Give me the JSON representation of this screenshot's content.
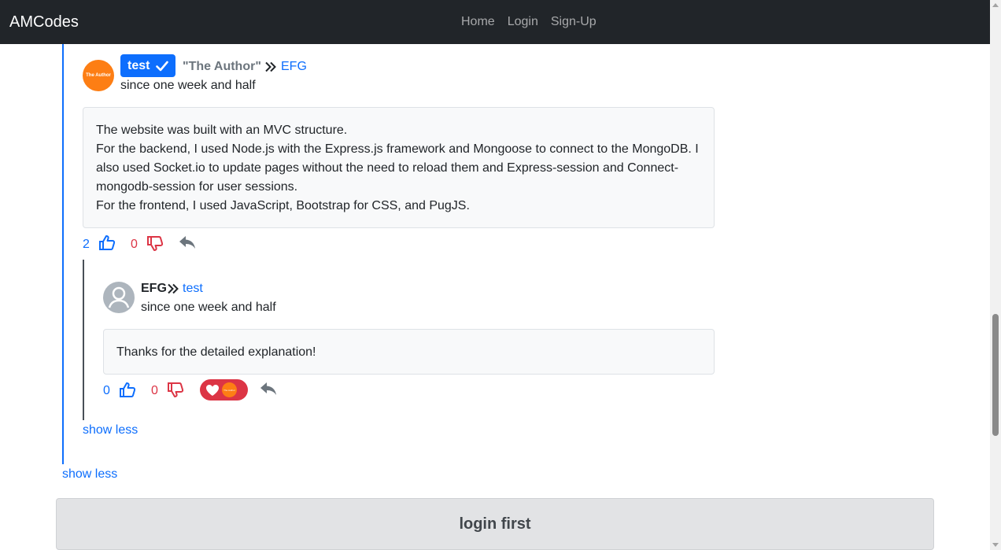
{
  "navbar": {
    "brand": "AMCodes",
    "links": [
      "Home",
      "Login",
      "Sign-Up"
    ]
  },
  "comment": {
    "avatar_text": "The Author",
    "user": "test",
    "author_tag": "\"The Author\"",
    "reply_to": "EFG",
    "time": "since one week and half",
    "body_lines": [
      "The website was built with an MVC structure.",
      "For the backend, I used Node.js with the Express.js framework and Mongoose to connect to the MongoDB. I also used Socket.io to update pages without the need to reload them and Express-session and Connect-mongodb-session for user sessions.",
      "For the frontend, I used JavaScript, Bootstrap for CSS, and PugJS."
    ],
    "likes": "2",
    "dislikes": "0"
  },
  "reply": {
    "user": "EFG",
    "reply_to": "test",
    "time": "since one week and half",
    "body": "Thanks for the detailed explanation!",
    "likes": "0",
    "dislikes": "0",
    "reaction_avatar_text": "The Author"
  },
  "show_less_inner": "show less",
  "show_less_outer": "show less",
  "login_prompt": "login first",
  "colors": {
    "primary": "#0d6efd",
    "danger": "#dc3545",
    "navbar": "#212529",
    "author_avatar": "#fd7e14"
  },
  "icons": {
    "verified": "check-icon",
    "reply_arrow": "double-chevron-right-icon",
    "like": "thumbs-up-icon",
    "dislike": "thumbs-down-icon",
    "reply": "reply-icon",
    "reaction": "heart-icon"
  }
}
